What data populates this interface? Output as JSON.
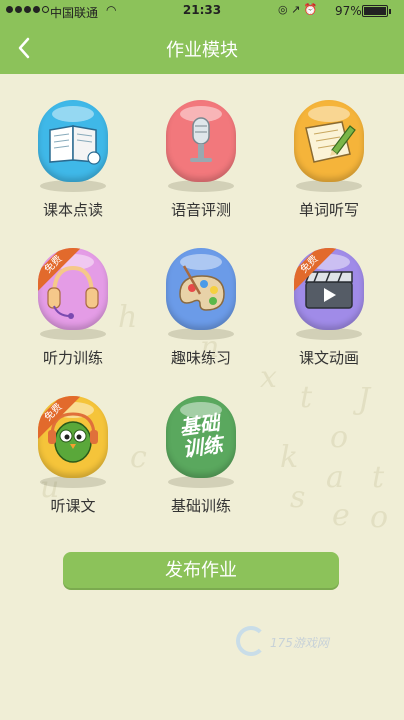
{
  "status_bar": {
    "carrier": "中国联通",
    "time": "21:33",
    "battery": "97%"
  },
  "nav": {
    "title": "作业模块"
  },
  "modules": [
    {
      "label": "课本点读",
      "color": "#3fb8e8",
      "icon": "book-icon",
      "badge": ""
    },
    {
      "label": "语音评测",
      "color": "#f2787c",
      "icon": "microphone-icon",
      "badge": ""
    },
    {
      "label": "单词听写",
      "color": "#f5b43a",
      "icon": "pencil-paper-icon",
      "badge": ""
    },
    {
      "label": "听力训练",
      "color": "#e49ce6",
      "icon": "headphones-icon",
      "badge": "免费"
    },
    {
      "label": "趣味练习",
      "color": "#6b9be8",
      "icon": "paint-palette-icon",
      "badge": ""
    },
    {
      "label": "课文动画",
      "color": "#a08be8",
      "icon": "video-icon",
      "badge": "免费"
    },
    {
      "label": "听课文",
      "color": "#f5c43a",
      "icon": "owl-headphones-icon",
      "badge": "免费"
    },
    {
      "label": "基础训练",
      "color": "#5aa85e",
      "icon": "basic-training-icon",
      "badge": "",
      "icon_text": "基础训练"
    }
  ],
  "publish_button": "发布作业",
  "watermark": "175游戏网"
}
